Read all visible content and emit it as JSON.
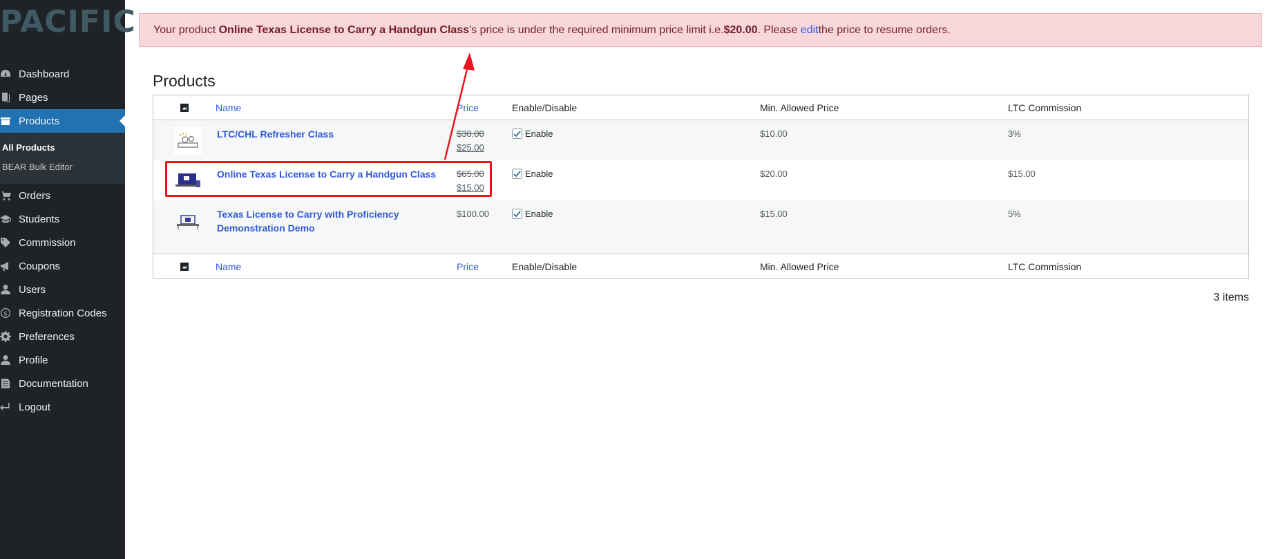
{
  "sidebar": {
    "logo": "PACIFIC",
    "items": [
      {
        "label": "Dashboard",
        "icon": "dashboard-icon"
      },
      {
        "label": "Pages",
        "icon": "pages-icon"
      },
      {
        "label": "Products",
        "icon": "archive-icon",
        "active": true
      },
      {
        "label": "Orders",
        "icon": "cart-icon"
      },
      {
        "label": "Students",
        "icon": "graduation-cap-icon"
      },
      {
        "label": "Commission",
        "icon": "tag-icon"
      },
      {
        "label": "Coupons",
        "icon": "megaphone-icon"
      },
      {
        "label": "Users",
        "icon": "user-icon"
      },
      {
        "label": "Registration Codes",
        "icon": "dollar-circle-icon"
      },
      {
        "label": "Preferences",
        "icon": "gear-icon"
      },
      {
        "label": "Profile",
        "icon": "user-icon"
      },
      {
        "label": "Documentation",
        "icon": "document-icon"
      },
      {
        "label": "Logout",
        "icon": "logout-arrow-icon"
      }
    ],
    "submenu": {
      "all_products": "All Products",
      "bulk_editor": "BEAR Bulk Editor"
    }
  },
  "notice": {
    "prefix": "Your product ",
    "product": "Online Texas License to Carry a Handgun Class",
    "middle": "'s price is under the required minimum price limit i.e. ",
    "limit": "$20.00",
    "after_limit": ". Please ",
    "link": "edit",
    "suffix": " the price to resume orders."
  },
  "page_title": "Products",
  "table": {
    "columns": {
      "name": "Name",
      "price": "Price",
      "enable": "Enable/Disable",
      "min_price": "Min. Allowed Price",
      "commission": "LTC Commission"
    },
    "rows": [
      {
        "name": "LTC/CHL Refresher Class",
        "old_price": "$30.00",
        "price": "$25.00",
        "enable_label": "Enable",
        "enabled": true,
        "min_price": "$10.00",
        "commission": "3%"
      },
      {
        "name": "Online Texas License to Carry a Handgun Class",
        "old_price": "$65.00",
        "price": "$15.00",
        "enable_label": "Enable",
        "enabled": true,
        "min_price": "$20.00",
        "commission": "$15.00"
      },
      {
        "name": "Texas License to Carry with Proficiency Demonstration Demo",
        "old_price": "",
        "price": "$100.00",
        "enable_label": "Enable",
        "enabled": true,
        "min_price": "$15.00",
        "commission": "5%"
      }
    ]
  },
  "items_count": "3 items",
  "colors": {
    "sidebar_bg": "#1f2328",
    "active_bg": "#2271b1",
    "notice_bg": "#f8d7da",
    "notice_text": "#721c24",
    "link": "#2f5bd3",
    "annotation_red": "#e8141e"
  }
}
